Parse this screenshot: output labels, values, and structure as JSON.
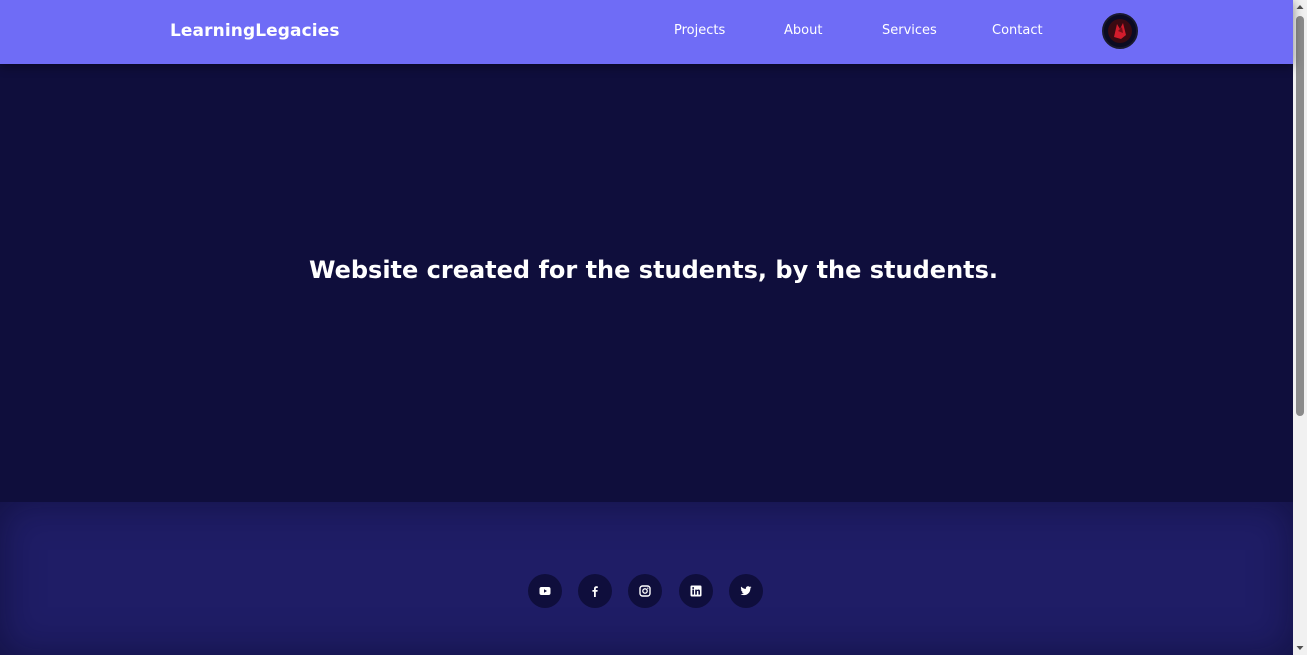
{
  "navbar": {
    "brand": "LearningLegacies",
    "links": [
      {
        "label": "Projects"
      },
      {
        "label": "About"
      },
      {
        "label": "Services"
      },
      {
        "label": "Contact"
      }
    ]
  },
  "hero": {
    "title": "Website created for the students, by the students."
  },
  "footer": {
    "social_icons": [
      "youtube-icon",
      "facebook-icon",
      "instagram-icon",
      "linkedin-icon",
      "twitter-icon"
    ]
  },
  "colors": {
    "navbar_bg": "#6f6cf6",
    "hero_bg": "#0f0e3c",
    "footer_bg": "#1f1d66",
    "text": "#ffffff"
  }
}
